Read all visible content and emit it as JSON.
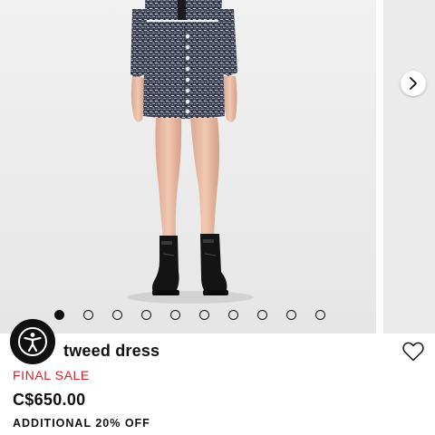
{
  "gallery": {
    "slide_count": 10,
    "active_index": 0,
    "next_icon": "chevron-right-icon",
    "image_subject": "model wearing grey tweed mini skirt with buttons and black combat boots"
  },
  "accessibility": {
    "icon": "accessibility-icon"
  },
  "product": {
    "title": "tweed dress",
    "sale_label": "FINAL SALE",
    "price": "C$650.00",
    "promo": "ADDITIONAL 20% OFF",
    "wishlist_icon": "heart-outline-icon"
  },
  "colors": {
    "sale": "#d41f26",
    "text": "#111111",
    "background": "#ececec"
  }
}
